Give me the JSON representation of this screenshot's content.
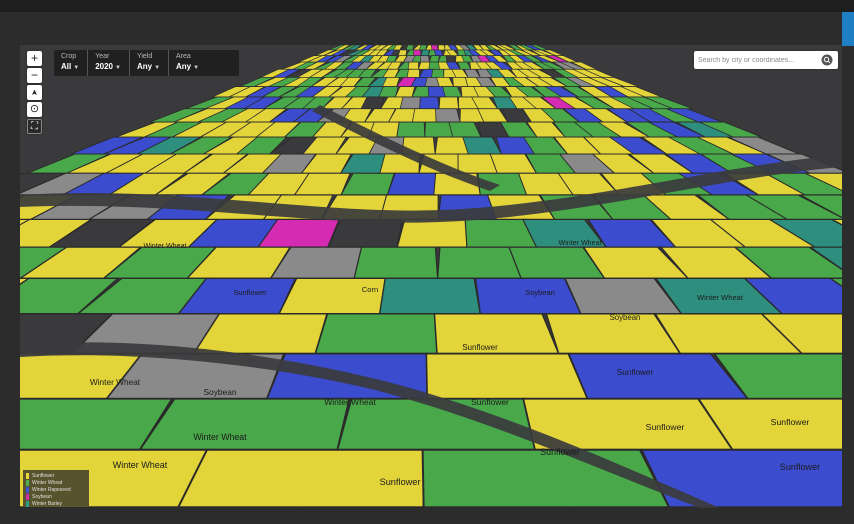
{
  "map": {
    "controls": {
      "zoom_in": "+",
      "zoom_out": "−",
      "compass": "➤",
      "locate": "⊙",
      "fullscreen": "⛶"
    },
    "filters": [
      {
        "label": "Crop",
        "value": "All"
      },
      {
        "label": "Year",
        "value": "2020"
      },
      {
        "label": "Yield",
        "value": "Any"
      },
      {
        "label": "Area",
        "value": "Any"
      }
    ],
    "search": {
      "placeholder": "Search by city or coordinates..."
    },
    "field_labels": [
      "Sunflower",
      "Sunflower",
      "Sunflower",
      "Sunflower",
      "Sunflower",
      "Sunflower",
      "Sunflower",
      "Winter Wheat",
      "Winter Wheat",
      "Winter Wheat",
      "Winter Wheat",
      "Winter Wheat",
      "Winter Wheat",
      "Soybean",
      "Soybean",
      "Soybean",
      "Corn",
      "Sunflower",
      "Winter Wheat",
      "Sunflower"
    ],
    "legend": [
      {
        "label": "Sunflower",
        "color": "#e9d73a"
      },
      {
        "label": "Winter Wheat",
        "color": "#4caf50"
      },
      {
        "label": "Winter Rapeseed",
        "color": "#3f51d6"
      },
      {
        "label": "Soybean",
        "color": "#d02ea8"
      },
      {
        "label": "Winter Barley",
        "color": "#2e9a8a"
      }
    ],
    "crop_colors": {
      "sunflower": "#e3d43a",
      "winter_wheat": "#49a84a",
      "rapeseed": "#3c4ccf",
      "soybean": "#d42bb2",
      "barley": "#2f8f7e",
      "fallow": "#8a8a8a",
      "corn": "#b8262c",
      "background": "#3a3a3c"
    }
  }
}
